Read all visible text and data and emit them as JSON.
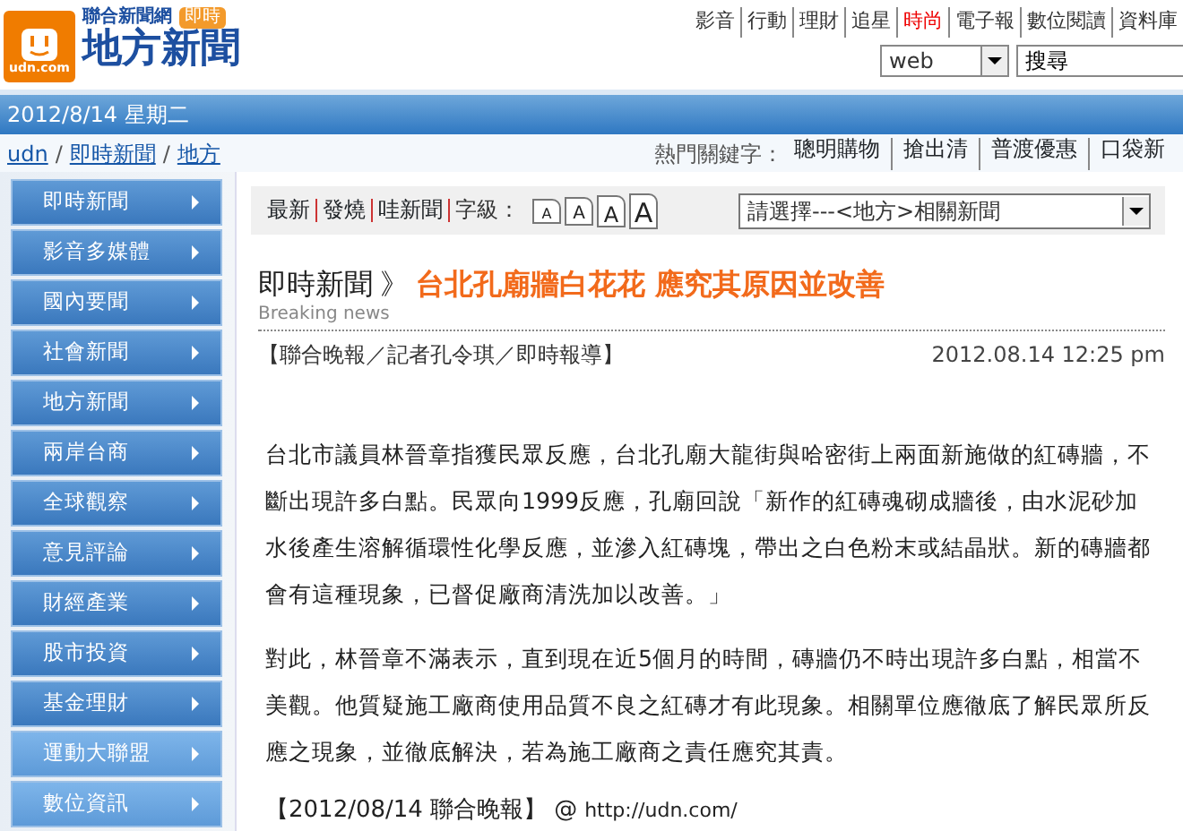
{
  "logo": {
    "site": "udn.com",
    "network": "聯合新聞網",
    "badge": "即時",
    "title": "地方新聞"
  },
  "top_nav": [
    {
      "label": "影音",
      "highlighted": false
    },
    {
      "label": "行動",
      "highlighted": false
    },
    {
      "label": "理財",
      "highlighted": false
    },
    {
      "label": "追星",
      "highlighted": false
    },
    {
      "label": "時尚",
      "highlighted": true
    },
    {
      "label": "電子報",
      "highlighted": false
    },
    {
      "label": "數位閱讀",
      "highlighted": false
    },
    {
      "label": "資料庫",
      "highlighted": false
    }
  ],
  "search": {
    "engine": "web",
    "value": "搜尋"
  },
  "date_bar": "2012/8/14 星期二",
  "breadcrumb": [
    {
      "kind": "link",
      "text": "udn"
    },
    {
      "kind": "separator",
      "text": "/"
    },
    {
      "kind": "link",
      "text": "即時新聞"
    },
    {
      "kind": "separator",
      "text": "/"
    },
    {
      "kind": "link",
      "text": "地方"
    }
  ],
  "hot_keywords": {
    "label": "熱門關鍵字：",
    "items": [
      "聰明購物",
      "搶出清",
      "普渡優惠",
      "口袋新"
    ]
  },
  "sidebar": {
    "items": [
      {
        "label": "即時新聞",
        "light": false
      },
      {
        "label": "影音多媒體",
        "light": false
      },
      {
        "label": "國內要聞",
        "light": false
      },
      {
        "label": "社會新聞",
        "light": false
      },
      {
        "label": "地方新聞",
        "light": false
      },
      {
        "label": "兩岸台商",
        "light": false
      },
      {
        "label": "全球觀察",
        "light": false
      },
      {
        "label": "意見評論",
        "light": false
      },
      {
        "label": "財經產業",
        "light": false
      },
      {
        "label": "股市投資",
        "light": false
      },
      {
        "label": "基金理財",
        "light": false
      },
      {
        "label": "運動大聯盟",
        "light": true
      },
      {
        "label": "數位資訊",
        "light": true
      }
    ]
  },
  "toolbar": {
    "links": [
      "最新",
      "發燒",
      "哇新聞"
    ],
    "font_size_label": "字級：",
    "font_sizes": [
      "A",
      "A",
      "A",
      "A"
    ],
    "related_select": "請選擇---<地方>相關新聞"
  },
  "article": {
    "section": "即時新聞",
    "separator": "》",
    "headline": "台北孔廟牆白花花 應究其原因並改善",
    "section_subtitle": "Breaking news",
    "byline": "【聯合晚報／記者孔令琪／即時報導】",
    "timestamp": "2012.08.14 12:25 pm",
    "paragraphs": [
      "台北市議員林晉章指獲民眾反應，台北孔廟大龍街與哈密街上兩面新施做的紅磚牆，不斷出現許多白點。民眾向1999反應，孔廟回說「新作的紅磚魂砌成牆後，由水泥砂加水後產生溶解循環性化學反應，並滲入紅磚塊，帶出之白色粉末或結晶狀。新的磚牆都會有這種現象，已督促廠商清洗加以改善。」",
      "對此，林晉章不滿表示，直到現在近5個月的時間，磚牆仍不時出現許多白點，相當不美觀。他質疑施工廠商使用品質不良之紅磚才有此現象。相關單位應徹底了解民眾所反應之現象，並徹底解決，若為施工廠商之責任應究其責。"
    ],
    "source": "【2012/08/14 聯合晚報】",
    "source_at": "@",
    "source_url": "http://udn.com/"
  }
}
